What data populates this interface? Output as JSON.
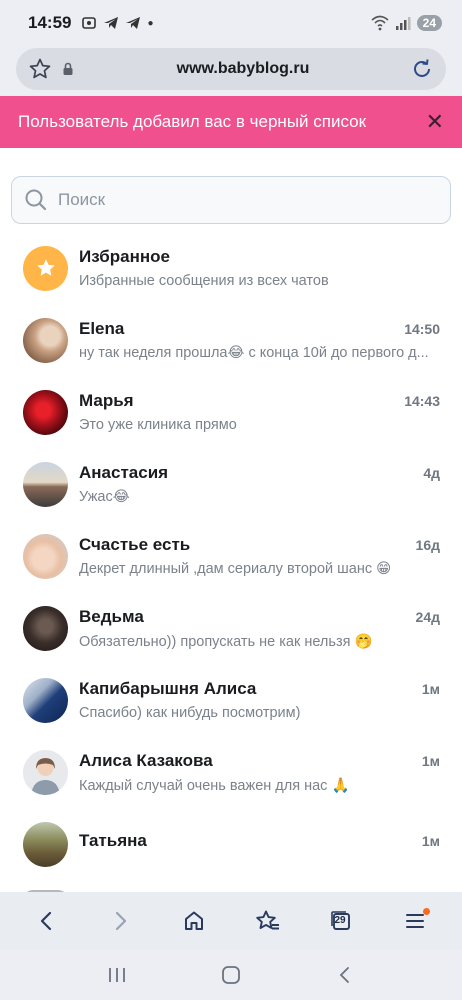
{
  "status_bar": {
    "time": "14:59",
    "battery": "24"
  },
  "address_bar": {
    "url": "www.babyblog.ru"
  },
  "banner": {
    "text": "Пользователь добавил вас в черный список"
  },
  "search": {
    "placeholder": "Поиск"
  },
  "chats": [
    {
      "name": "Избранное",
      "preview": "Избранные сообщения из всех чатов",
      "time": ""
    },
    {
      "name": "Elena",
      "preview": "ну так неделя прошла😂 с конца 10й до первого д...",
      "time": "14:50"
    },
    {
      "name": "Марья",
      "preview": "Это уже клиника прямо",
      "time": "14:43"
    },
    {
      "name": "Анастасия",
      "preview": "Ужас😂",
      "time": "4д"
    },
    {
      "name": "Счастье есть",
      "preview": "Декрет длинный ,дам сериалу второй шанс 😁",
      "time": "16д"
    },
    {
      "name": "Ведьма",
      "preview": "Обязательно)) пропускать не как нельзя 🤭",
      "time": "24д"
    },
    {
      "name": "Капибарышня Алиса",
      "preview": "Спасибо) как нибудь посмотрим)",
      "time": "1м"
    },
    {
      "name": "Алиса Казакова",
      "preview": "Каждый случай очень важен для нас 🙏",
      "time": "1м"
    },
    {
      "name": "Татьяна",
      "preview": "",
      "time": "1м"
    }
  ],
  "toolbar": {
    "tabs_count": "29"
  },
  "colors": {
    "banner": "#f0508e",
    "favorite": "#ffb547",
    "notification_dot": "#ff6a1a"
  },
  "icons": [
    "star-icon",
    "lock-icon",
    "reload-icon",
    "close-icon",
    "search-icon",
    "back-icon",
    "forward-icon",
    "home-icon",
    "bookmarks-icon",
    "tabs-icon",
    "menu-icon"
  ]
}
